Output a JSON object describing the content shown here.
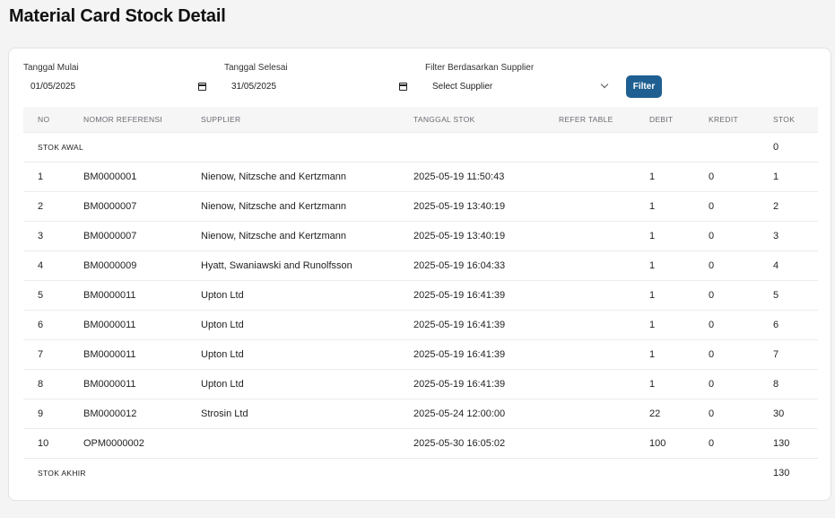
{
  "page": {
    "title": "Material Card Stock Detail"
  },
  "filters": {
    "start_label": "Tanggal Mulai",
    "start_value": "01/05/2025",
    "end_label": "Tanggal Selesai",
    "end_value": "31/05/2025",
    "supplier_label": "Filter Berdasarkan Supplier",
    "supplier_value": "Select Supplier",
    "button_label": "Filter"
  },
  "table": {
    "headers": {
      "no": "NO",
      "ref": "NOMOR REFERENSI",
      "supplier": "SUPPLIER",
      "date": "TANGGAL STOK",
      "refer": "REFER TABLE",
      "debit": "DEBIT",
      "kredit": "KREDIT",
      "stok": "STOK"
    },
    "opening": {
      "label": "STOK AWAL",
      "stok": "0"
    },
    "rows": [
      {
        "no": "1",
        "ref": "BM0000001",
        "supplier": "Nienow, Nitzsche and Kertzmann",
        "date": "2025-05-19 11:50:43",
        "refer": "",
        "debit": "1",
        "kredit": "0",
        "stok": "1"
      },
      {
        "no": "2",
        "ref": "BM0000007",
        "supplier": "Nienow, Nitzsche and Kertzmann",
        "date": "2025-05-19 13:40:19",
        "refer": "",
        "debit": "1",
        "kredit": "0",
        "stok": "2"
      },
      {
        "no": "3",
        "ref": "BM0000007",
        "supplier": "Nienow, Nitzsche and Kertzmann",
        "date": "2025-05-19 13:40:19",
        "refer": "",
        "debit": "1",
        "kredit": "0",
        "stok": "3"
      },
      {
        "no": "4",
        "ref": "BM0000009",
        "supplier": "Hyatt, Swaniawski and Runolfsson",
        "date": "2025-05-19 16:04:33",
        "refer": "",
        "debit": "1",
        "kredit": "0",
        "stok": "4"
      },
      {
        "no": "5",
        "ref": "BM0000011",
        "supplier": "Upton Ltd",
        "date": "2025-05-19 16:41:39",
        "refer": "",
        "debit": "1",
        "kredit": "0",
        "stok": "5"
      },
      {
        "no": "6",
        "ref": "BM0000011",
        "supplier": "Upton Ltd",
        "date": "2025-05-19 16:41:39",
        "refer": "",
        "debit": "1",
        "kredit": "0",
        "stok": "6"
      },
      {
        "no": "7",
        "ref": "BM0000011",
        "supplier": "Upton Ltd",
        "date": "2025-05-19 16:41:39",
        "refer": "",
        "debit": "1",
        "kredit": "0",
        "stok": "7"
      },
      {
        "no": "8",
        "ref": "BM0000011",
        "supplier": "Upton Ltd",
        "date": "2025-05-19 16:41:39",
        "refer": "",
        "debit": "1",
        "kredit": "0",
        "stok": "8"
      },
      {
        "no": "9",
        "ref": "BM0000012",
        "supplier": "Strosin Ltd",
        "date": "2025-05-24 12:00:00",
        "refer": "",
        "debit": "22",
        "kredit": "0",
        "stok": "30"
      },
      {
        "no": "10",
        "ref": "OPM0000002",
        "supplier": "",
        "date": "2025-05-30 16:05:02",
        "refer": "",
        "debit": "100",
        "kredit": "0",
        "stok": "130"
      }
    ],
    "closing": {
      "label": "STOK AKHIR",
      "stok": "130"
    }
  },
  "colors": {
    "accent": "#1f5f91",
    "background": "#f4f4f5",
    "header_row": "#f6f6f7"
  },
  "icons": {
    "date_picker": "calendar-icon",
    "select": "chevron-down-icon"
  }
}
